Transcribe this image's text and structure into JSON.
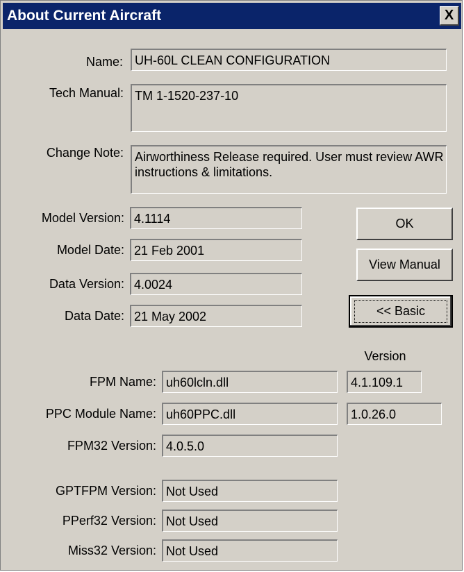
{
  "window": {
    "title": "About Current Aircraft",
    "close_glyph": "X"
  },
  "fields": {
    "name": {
      "label": "Name:",
      "value": "UH-60L CLEAN CONFIGURATION"
    },
    "tech_manual": {
      "label": "Tech Manual:",
      "value": "TM 1-1520-237-10"
    },
    "change_note": {
      "label": "Change Note:",
      "value": "Airworthiness Release required. User must review AWR instructions & limitations."
    },
    "model_version": {
      "label": "Model Version:",
      "value": "4.1114"
    },
    "model_date": {
      "label": "Model Date:",
      "value": "21 Feb 2001"
    },
    "data_version": {
      "label": "Data Version:",
      "value": "4.0024"
    },
    "data_date": {
      "label": "Data Date:",
      "value": "21 May 2002"
    }
  },
  "buttons": {
    "ok": "OK",
    "view_manual": "View Manual",
    "basic": "<< Basic"
  },
  "modules": {
    "version_header": "Version",
    "fpm_name": {
      "label": "FPM Name:",
      "value": "uh60lcln.dll",
      "version": "4.1.109.1"
    },
    "ppc_module_name": {
      "label": "PPC Module Name:",
      "value": "uh60PPC.dll",
      "version": "1.0.26.0"
    },
    "fpm32_version": {
      "label": "FPM32 Version:",
      "value": "4.0.5.0"
    },
    "gptfpm_version": {
      "label": "GPTFPM Version:",
      "value": "Not Used"
    },
    "pperf32_version": {
      "label": "PPerf32 Version:",
      "value": "Not Used"
    },
    "miss32_version": {
      "label": "Miss32 Version:",
      "value": "Not Used"
    }
  }
}
